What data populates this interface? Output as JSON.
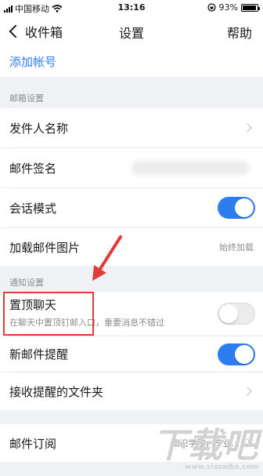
{
  "status_bar": {
    "carrier": "中国移动",
    "time": "13:16",
    "battery_percent": "93%",
    "battery_level": 0.93,
    "icons": [
      "signal-icon",
      "wifi-icon",
      "lock-rotation-icon",
      "battery-icon"
    ]
  },
  "nav": {
    "back_label": "收件箱",
    "title": "设置",
    "help_label": "帮助"
  },
  "add_account": {
    "label": "添加帐号",
    "color": "#2b7df0"
  },
  "mailbox_section": {
    "header": "邮箱设置",
    "sender_name": "发件人名称",
    "signature": "邮件签名",
    "conversation_mode": {
      "label": "会话模式",
      "on": true
    },
    "load_images": {
      "label": "加载邮件图片",
      "value": "始终加载"
    }
  },
  "notification_section": {
    "header": "通知设置",
    "pin_chat": {
      "label": "置顶聊天",
      "description": "在聊天中置顶钉邮入口，重要消息不错过",
      "on": false
    },
    "new_mail_alert": {
      "label": "新邮件提醒",
      "on": true
    },
    "alert_folders": {
      "label": "接收提醒的文件夹"
    }
  },
  "subscription": {
    "label": "邮件订阅",
    "value": "知识学院，产业..."
  },
  "watermark": {
    "logo": "下载吧",
    "url": "www.xiazaiba.com"
  },
  "colors": {
    "accent": "#2b7df0",
    "annotation": "#e23a3a"
  }
}
